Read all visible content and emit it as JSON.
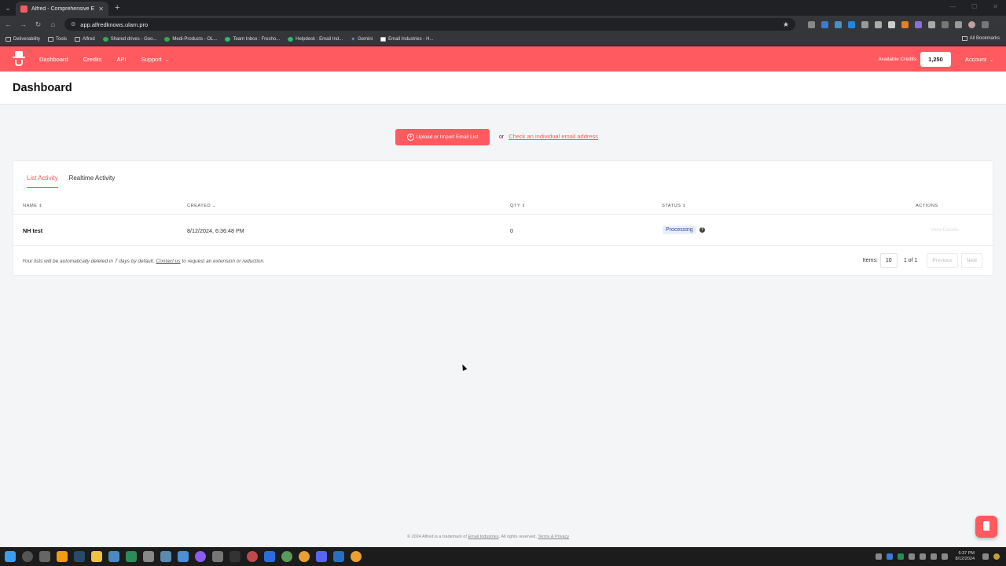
{
  "browser": {
    "tab_title": "Alfred - Comprehensive Email V",
    "url": "app.alfredknows.ulam.pro",
    "bookmarks": [
      {
        "label": "Deliverability"
      },
      {
        "label": "Tools"
      },
      {
        "label": "Alfred"
      },
      {
        "label": "Shared drives - Goo..."
      },
      {
        "label": "Medi-Products - OL..."
      },
      {
        "label": "Team Inbox : Fresho..."
      },
      {
        "label": "Helpdesk : Email Ind..."
      },
      {
        "label": "Gemini"
      },
      {
        "label": "Email Industries - H..."
      }
    ],
    "all_bookmarks": "All Bookmarks"
  },
  "nav": {
    "items": [
      {
        "label": "Dashboard"
      },
      {
        "label": "Credits"
      },
      {
        "label": "API"
      },
      {
        "label": "Support"
      }
    ],
    "credits_label": "Available Credits",
    "credits_value": "1,250",
    "account": "Account"
  },
  "page": {
    "title": "Dashboard",
    "upload_button": "Upload or Import Email List",
    "or_text": "or",
    "check_link": "Check an individual email address"
  },
  "tabs": [
    {
      "label": "List Activity",
      "active": true
    },
    {
      "label": "Realtime Activity",
      "active": false
    }
  ],
  "table": {
    "headers": {
      "name": "NAME",
      "created": "CREATED",
      "qty": "QTY",
      "status": "STATUS",
      "actions": "ACTIONS"
    },
    "rows": [
      {
        "name": "NH test",
        "created": "8/12/2024, 6:36:48 PM",
        "qty": "0",
        "status": "Processing",
        "action": "View Details"
      }
    ]
  },
  "footer_note": {
    "before": "Your lists will be automatically deleted in 7 days by default.",
    "link": "Contact us",
    "after": "to request an extension or reduction."
  },
  "pagination": {
    "items_label": "Items:",
    "per_page": "10",
    "page_info": "1 of 1",
    "previous": "Previous",
    "next": "Next"
  },
  "copyright": {
    "before": "© 2024 Alfred is a trademark of",
    "company": "Email Industries",
    "after": ". All rights reserved.",
    "terms": "Terms & Privacy"
  },
  "clock": {
    "time": "6:37 PM",
    "date": "8/12/2024"
  },
  "colors": {
    "brand": "#ff5a5f",
    "status_bg": "#eaf0fb"
  }
}
